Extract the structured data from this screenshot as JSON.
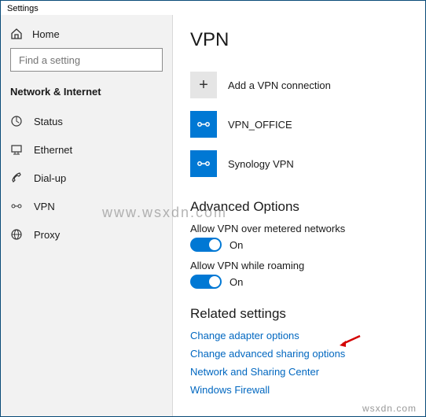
{
  "window_title": "Settings",
  "sidebar": {
    "home": "Home",
    "search_placeholder": "Find a setting",
    "section": "Network & Internet",
    "items": [
      {
        "label": "Status"
      },
      {
        "label": "Ethernet"
      },
      {
        "label": "Dial-up"
      },
      {
        "label": "VPN"
      },
      {
        "label": "Proxy"
      }
    ]
  },
  "main": {
    "title": "VPN",
    "add_label": "Add a VPN connection",
    "connections": [
      {
        "label": "VPN_OFFICE"
      },
      {
        "label": "Synology VPN"
      }
    ],
    "advanced_heading": "Advanced Options",
    "opt_metered_label": "Allow VPN over metered networks",
    "opt_roaming_label": "Allow VPN while roaming",
    "toggle_on_text": "On",
    "related_heading": "Related settings",
    "links": [
      "Change adapter options",
      "Change advanced sharing options",
      "Network and Sharing Center",
      "Windows Firewall"
    ]
  },
  "watermark": "www.wsxdn.com",
  "footer_watermark": "wsxdn.com"
}
